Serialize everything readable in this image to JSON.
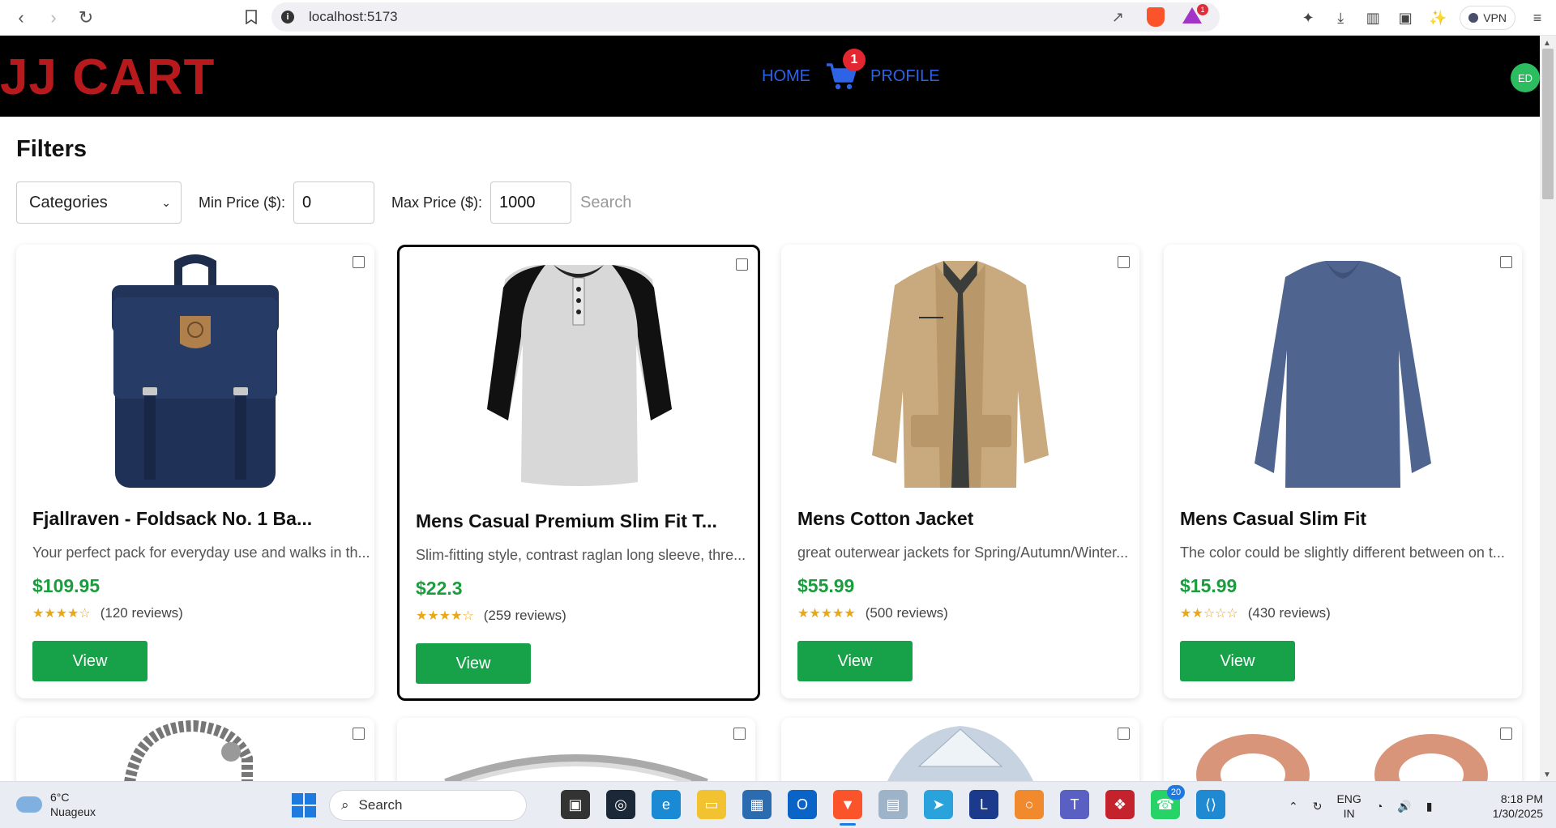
{
  "browser": {
    "url": "localhost:5173",
    "rewards_badge": "1",
    "vpn_label": "VPN"
  },
  "app": {
    "brand": "JJ CART",
    "nav": {
      "home": "HOME",
      "profile": "PROFILE"
    },
    "cart_count": "1",
    "avatar_initials": "ED"
  },
  "filters": {
    "title": "Filters",
    "category_selected": "Categories",
    "min_label": "Min Price ($):",
    "min_value": "0",
    "max_label": "Max Price ($):",
    "max_value": "1000",
    "search_label": "Search"
  },
  "products": [
    {
      "name": "Fjallraven - Foldsack No. 1 Ba...",
      "description": "Your perfect pack for everyday use and walks in th...",
      "price": "$109.95",
      "stars": "★★★★☆",
      "reviews": "(120 reviews)",
      "button": "View",
      "image_icon": "backpack-image"
    },
    {
      "name": "Mens Casual Premium Slim Fit T...",
      "description": "Slim-fitting style, contrast raglan long sleeve, thre...",
      "price": "$22.3",
      "stars": "★★★★☆",
      "reviews": "(259 reviews)",
      "button": "View",
      "image_icon": "raglan-shirt-image"
    },
    {
      "name": "Mens Cotton Jacket",
      "description": "great outerwear jackets for Spring/Autumn/Winter...",
      "price": "$55.99",
      "stars": "★★★★★",
      "reviews": "(500 reviews)",
      "button": "View",
      "image_icon": "jacket-image"
    },
    {
      "name": "Mens Casual Slim Fit",
      "description": "The color could be slightly different between on t...",
      "price": "$15.99",
      "stars": "★★☆☆☆",
      "reviews": "(430 reviews)",
      "button": "View",
      "image_icon": "longsleeve-image"
    }
  ],
  "taskbar": {
    "weather_temp": "6°C",
    "weather_desc": "Nuageux",
    "search_placeholder": "Search",
    "whatsapp_badge": "20",
    "lang_top": "ENG",
    "lang_bottom": "IN",
    "time": "8:18 PM",
    "date": "1/30/2025"
  },
  "colors": {
    "brand_red": "#b7191c",
    "nav_blue": "#2e63e6",
    "price_green": "#1b9c3e",
    "button_green": "#17a148",
    "header_bg": "#000000"
  }
}
